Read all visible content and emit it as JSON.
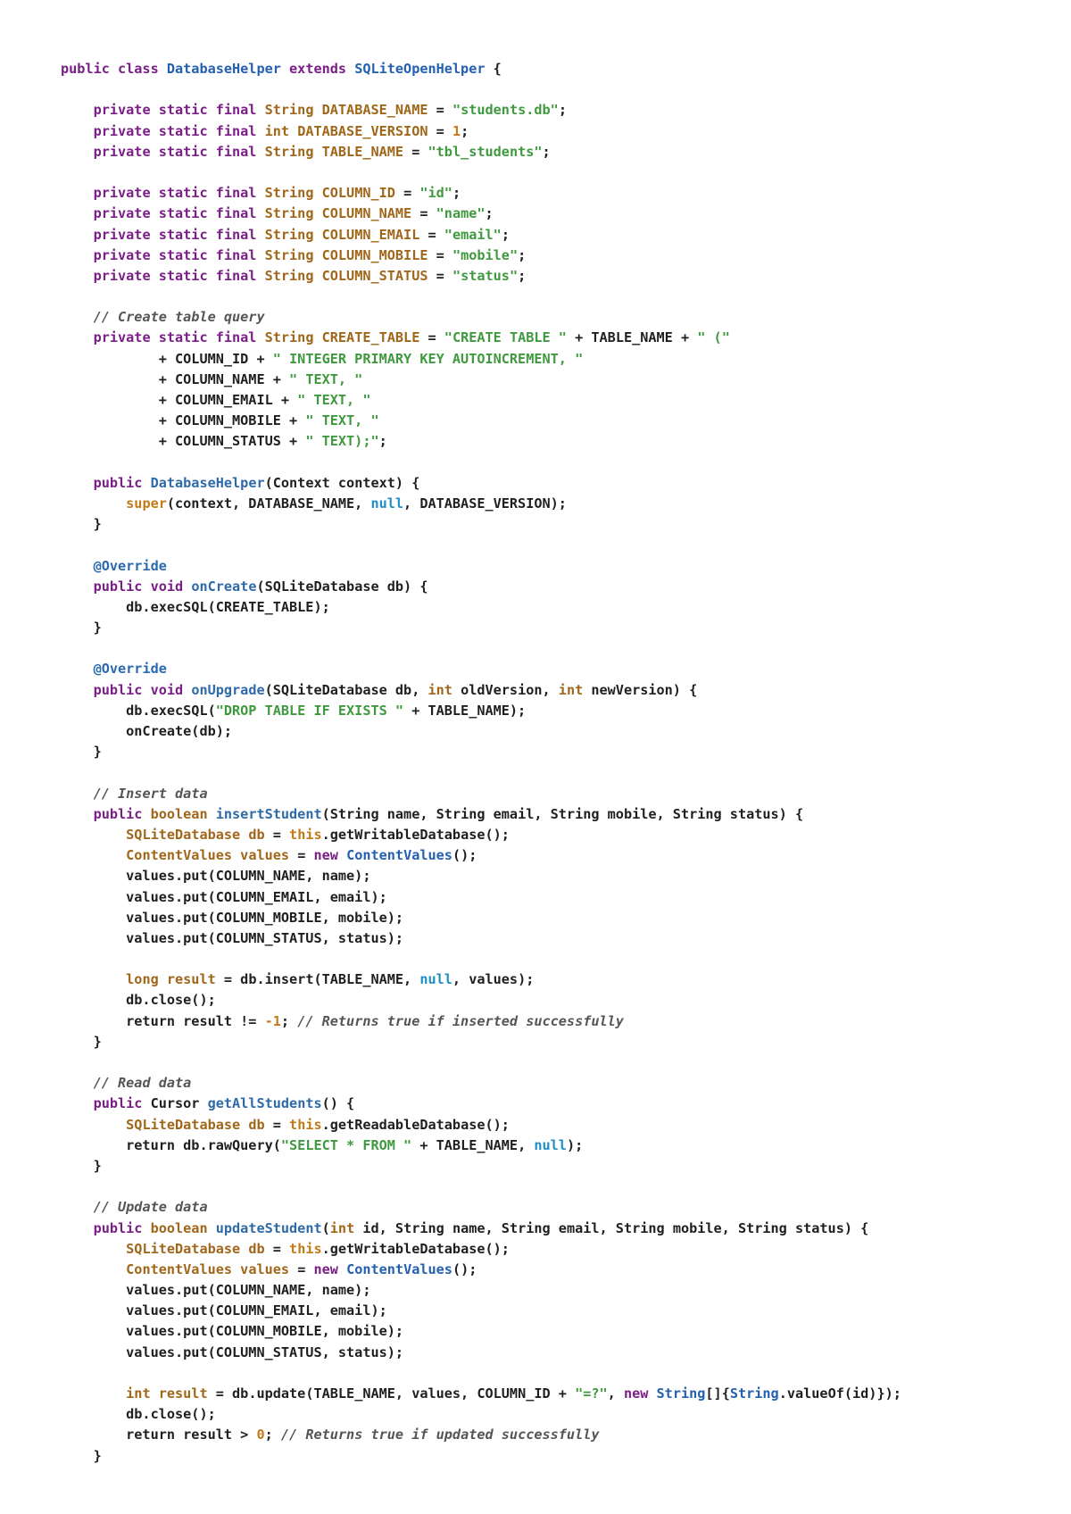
{
  "lines": [
    [
      [
        "keyword",
        "public class "
      ],
      [
        "class",
        "DatabaseHelper "
      ],
      [
        "keyword",
        "extends "
      ],
      [
        "class",
        "SQLiteOpenHelper"
      ],
      [
        "plain",
        " {"
      ]
    ],
    [],
    [
      [
        "plain",
        "    "
      ],
      [
        "keyword",
        "private static final "
      ],
      [
        "type",
        "String "
      ],
      [
        "var",
        "DATABASE_NAME "
      ],
      [
        "plain",
        "= "
      ],
      [
        "string",
        "\"students.db\""
      ],
      [
        "plain",
        ";"
      ]
    ],
    [
      [
        "plain",
        "    "
      ],
      [
        "keyword",
        "private static final "
      ],
      [
        "type",
        "int "
      ],
      [
        "var",
        "DATABASE_VERSION "
      ],
      [
        "plain",
        "= "
      ],
      [
        "number",
        "1"
      ],
      [
        "plain",
        ";"
      ]
    ],
    [
      [
        "plain",
        "    "
      ],
      [
        "keyword",
        "private static final "
      ],
      [
        "type",
        "String "
      ],
      [
        "var",
        "TABLE_NAME "
      ],
      [
        "plain",
        "= "
      ],
      [
        "string",
        "\"tbl_students\""
      ],
      [
        "plain",
        ";"
      ]
    ],
    [],
    [
      [
        "plain",
        "    "
      ],
      [
        "keyword",
        "private static final "
      ],
      [
        "type",
        "String "
      ],
      [
        "var",
        "COLUMN_ID "
      ],
      [
        "plain",
        "= "
      ],
      [
        "string",
        "\"id\""
      ],
      [
        "plain",
        ";"
      ]
    ],
    [
      [
        "plain",
        "    "
      ],
      [
        "keyword",
        "private static final "
      ],
      [
        "type",
        "String "
      ],
      [
        "var",
        "COLUMN_NAME "
      ],
      [
        "plain",
        "= "
      ],
      [
        "string",
        "\"name\""
      ],
      [
        "plain",
        ";"
      ]
    ],
    [
      [
        "plain",
        "    "
      ],
      [
        "keyword",
        "private static final "
      ],
      [
        "type",
        "String "
      ],
      [
        "var",
        "COLUMN_EMAIL "
      ],
      [
        "plain",
        "= "
      ],
      [
        "string",
        "\"email\""
      ],
      [
        "plain",
        ";"
      ]
    ],
    [
      [
        "plain",
        "    "
      ],
      [
        "keyword",
        "private static final "
      ],
      [
        "type",
        "String "
      ],
      [
        "var",
        "COLUMN_MOBILE "
      ],
      [
        "plain",
        "= "
      ],
      [
        "string",
        "\"mobile\""
      ],
      [
        "plain",
        ";"
      ]
    ],
    [
      [
        "plain",
        "    "
      ],
      [
        "keyword",
        "private static final "
      ],
      [
        "type",
        "String "
      ],
      [
        "var",
        "COLUMN_STATUS "
      ],
      [
        "plain",
        "= "
      ],
      [
        "string",
        "\"status\""
      ],
      [
        "plain",
        ";"
      ]
    ],
    [],
    [
      [
        "plain",
        "    "
      ],
      [
        "comment",
        "// Create table query"
      ]
    ],
    [
      [
        "plain",
        "    "
      ],
      [
        "keyword",
        "private static final "
      ],
      [
        "type",
        "String "
      ],
      [
        "var",
        "CREATE_TABLE "
      ],
      [
        "plain",
        "= "
      ],
      [
        "string",
        "\"CREATE TABLE \""
      ],
      [
        "plain",
        " + TABLE_NAME + "
      ],
      [
        "string",
        "\" (\""
      ]
    ],
    [
      [
        "plain",
        "            + COLUMN_ID + "
      ],
      [
        "string",
        "\" INTEGER PRIMARY KEY AUTOINCREMENT, \""
      ]
    ],
    [
      [
        "plain",
        "            + COLUMN_NAME + "
      ],
      [
        "string",
        "\" TEXT, \""
      ]
    ],
    [
      [
        "plain",
        "            + COLUMN_EMAIL + "
      ],
      [
        "string",
        "\" TEXT, \""
      ]
    ],
    [
      [
        "plain",
        "            + COLUMN_MOBILE + "
      ],
      [
        "string",
        "\" TEXT, \""
      ]
    ],
    [
      [
        "plain",
        "            + COLUMN_STATUS + "
      ],
      [
        "string",
        "\" TEXT);\""
      ],
      [
        "plain",
        ";"
      ]
    ],
    [],
    [
      [
        "plain",
        "    "
      ],
      [
        "keyword",
        "public "
      ],
      [
        "method",
        "DatabaseHelper"
      ],
      [
        "plain",
        "(Context context) {"
      ]
    ],
    [
      [
        "plain",
        "        "
      ],
      [
        "super",
        "super"
      ],
      [
        "plain",
        "(context, DATABASE_NAME, "
      ],
      [
        "null",
        "null"
      ],
      [
        "plain",
        ", DATABASE_VERSION);"
      ]
    ],
    [
      [
        "plain",
        "    }"
      ]
    ],
    [],
    [
      [
        "plain",
        "    "
      ],
      [
        "annotation",
        "@Override"
      ]
    ],
    [
      [
        "plain",
        "    "
      ],
      [
        "keyword",
        "public void "
      ],
      [
        "method",
        "onCreate"
      ],
      [
        "plain",
        "(SQLiteDatabase db) {"
      ]
    ],
    [
      [
        "plain",
        "        db.execSQL(CREATE_TABLE);"
      ]
    ],
    [
      [
        "plain",
        "    }"
      ]
    ],
    [],
    [
      [
        "plain",
        "    "
      ],
      [
        "annotation",
        "@Override"
      ]
    ],
    [
      [
        "plain",
        "    "
      ],
      [
        "keyword",
        "public void "
      ],
      [
        "method",
        "onUpgrade"
      ],
      [
        "plain",
        "(SQLiteDatabase db, "
      ],
      [
        "type",
        "int "
      ],
      [
        "plain",
        "oldVersion, "
      ],
      [
        "type",
        "int "
      ],
      [
        "plain",
        "newVersion) {"
      ]
    ],
    [
      [
        "plain",
        "        db.execSQL("
      ],
      [
        "string",
        "\"DROP TABLE IF EXISTS \""
      ],
      [
        "plain",
        " + TABLE_NAME);"
      ]
    ],
    [
      [
        "plain",
        "        onCreate(db);"
      ]
    ],
    [
      [
        "plain",
        "    }"
      ]
    ],
    [],
    [
      [
        "plain",
        "    "
      ],
      [
        "comment",
        "// Insert data"
      ]
    ],
    [
      [
        "plain",
        "    "
      ],
      [
        "keyword",
        "public "
      ],
      [
        "type",
        "boolean "
      ],
      [
        "method",
        "insertStudent"
      ],
      [
        "plain",
        "(String name, String email, String mobile, String status) {"
      ]
    ],
    [
      [
        "plain",
        "        "
      ],
      [
        "type",
        "SQLiteDatabase "
      ],
      [
        "var",
        "db "
      ],
      [
        "plain",
        "= "
      ],
      [
        "super",
        "this"
      ],
      [
        "plain",
        ".getWritableDatabase();"
      ]
    ],
    [
      [
        "plain",
        "        "
      ],
      [
        "type",
        "ContentValues "
      ],
      [
        "var",
        "values "
      ],
      [
        "plain",
        "= "
      ],
      [
        "keyword",
        "new "
      ],
      [
        "class",
        "ContentValues"
      ],
      [
        "plain",
        "();"
      ]
    ],
    [
      [
        "plain",
        "        values.put(COLUMN_NAME, name);"
      ]
    ],
    [
      [
        "plain",
        "        values.put(COLUMN_EMAIL, email);"
      ]
    ],
    [
      [
        "plain",
        "        values.put(COLUMN_MOBILE, mobile);"
      ]
    ],
    [
      [
        "plain",
        "        values.put(COLUMN_STATUS, status);"
      ]
    ],
    [],
    [
      [
        "plain",
        "        "
      ],
      [
        "type",
        "long "
      ],
      [
        "var",
        "result "
      ],
      [
        "plain",
        "= db.insert(TABLE_NAME, "
      ],
      [
        "null",
        "null"
      ],
      [
        "plain",
        ", values);"
      ]
    ],
    [
      [
        "plain",
        "        db.close();"
      ]
    ],
    [
      [
        "plain",
        "        return result != "
      ],
      [
        "number",
        "-1"
      ],
      [
        "plain",
        "; "
      ],
      [
        "comment",
        "// Returns true if inserted successfully"
      ]
    ],
    [
      [
        "plain",
        "    }"
      ]
    ],
    [],
    [
      [
        "plain",
        "    "
      ],
      [
        "comment",
        "// Read data"
      ]
    ],
    [
      [
        "plain",
        "    "
      ],
      [
        "keyword",
        "public "
      ],
      [
        "plain",
        "Cursor "
      ],
      [
        "method",
        "getAllStudents"
      ],
      [
        "plain",
        "() {"
      ]
    ],
    [
      [
        "plain",
        "        "
      ],
      [
        "type",
        "SQLiteDatabase "
      ],
      [
        "var",
        "db "
      ],
      [
        "plain",
        "= "
      ],
      [
        "super",
        "this"
      ],
      [
        "plain",
        ".getReadableDatabase();"
      ]
    ],
    [
      [
        "plain",
        "        return db.rawQuery("
      ],
      [
        "string",
        "\"SELECT * FROM \""
      ],
      [
        "plain",
        " + TABLE_NAME, "
      ],
      [
        "null",
        "null"
      ],
      [
        "plain",
        ");"
      ]
    ],
    [
      [
        "plain",
        "    }"
      ]
    ],
    [],
    [
      [
        "plain",
        "    "
      ],
      [
        "comment",
        "// Update data"
      ]
    ],
    [
      [
        "plain",
        "    "
      ],
      [
        "keyword",
        "public "
      ],
      [
        "type",
        "boolean "
      ],
      [
        "method",
        "updateStudent"
      ],
      [
        "plain",
        "("
      ],
      [
        "type",
        "int "
      ],
      [
        "plain",
        "id, String name, String email, String mobile, String status) {"
      ]
    ],
    [
      [
        "plain",
        "        "
      ],
      [
        "type",
        "SQLiteDatabase "
      ],
      [
        "var",
        "db "
      ],
      [
        "plain",
        "= "
      ],
      [
        "super",
        "this"
      ],
      [
        "plain",
        ".getWritableDatabase();"
      ]
    ],
    [
      [
        "plain",
        "        "
      ],
      [
        "type",
        "ContentValues "
      ],
      [
        "var",
        "values "
      ],
      [
        "plain",
        "= "
      ],
      [
        "keyword",
        "new "
      ],
      [
        "class",
        "ContentValues"
      ],
      [
        "plain",
        "();"
      ]
    ],
    [
      [
        "plain",
        "        values.put(COLUMN_NAME, name);"
      ]
    ],
    [
      [
        "plain",
        "        values.put(COLUMN_EMAIL, email);"
      ]
    ],
    [
      [
        "plain",
        "        values.put(COLUMN_MOBILE, mobile);"
      ]
    ],
    [
      [
        "plain",
        "        values.put(COLUMN_STATUS, status);"
      ]
    ],
    [],
    [
      [
        "plain",
        "        "
      ],
      [
        "type",
        "int "
      ],
      [
        "var",
        "result "
      ],
      [
        "plain",
        "= db.update(TABLE_NAME, values, COLUMN_ID + "
      ],
      [
        "string",
        "\"=?\""
      ],
      [
        "plain",
        ", "
      ],
      [
        "keyword",
        "new "
      ],
      [
        "class",
        "String"
      ],
      [
        "plain",
        "[]{"
      ],
      [
        "class",
        "String"
      ],
      [
        "plain",
        ".valueOf(id)});"
      ]
    ],
    [
      [
        "plain",
        "        db.close();"
      ]
    ],
    [
      [
        "plain",
        "        return result > "
      ],
      [
        "number",
        "0"
      ],
      [
        "plain",
        "; "
      ],
      [
        "comment",
        "// Returns true if updated successfully"
      ]
    ],
    [
      [
        "plain",
        "    }"
      ]
    ]
  ]
}
